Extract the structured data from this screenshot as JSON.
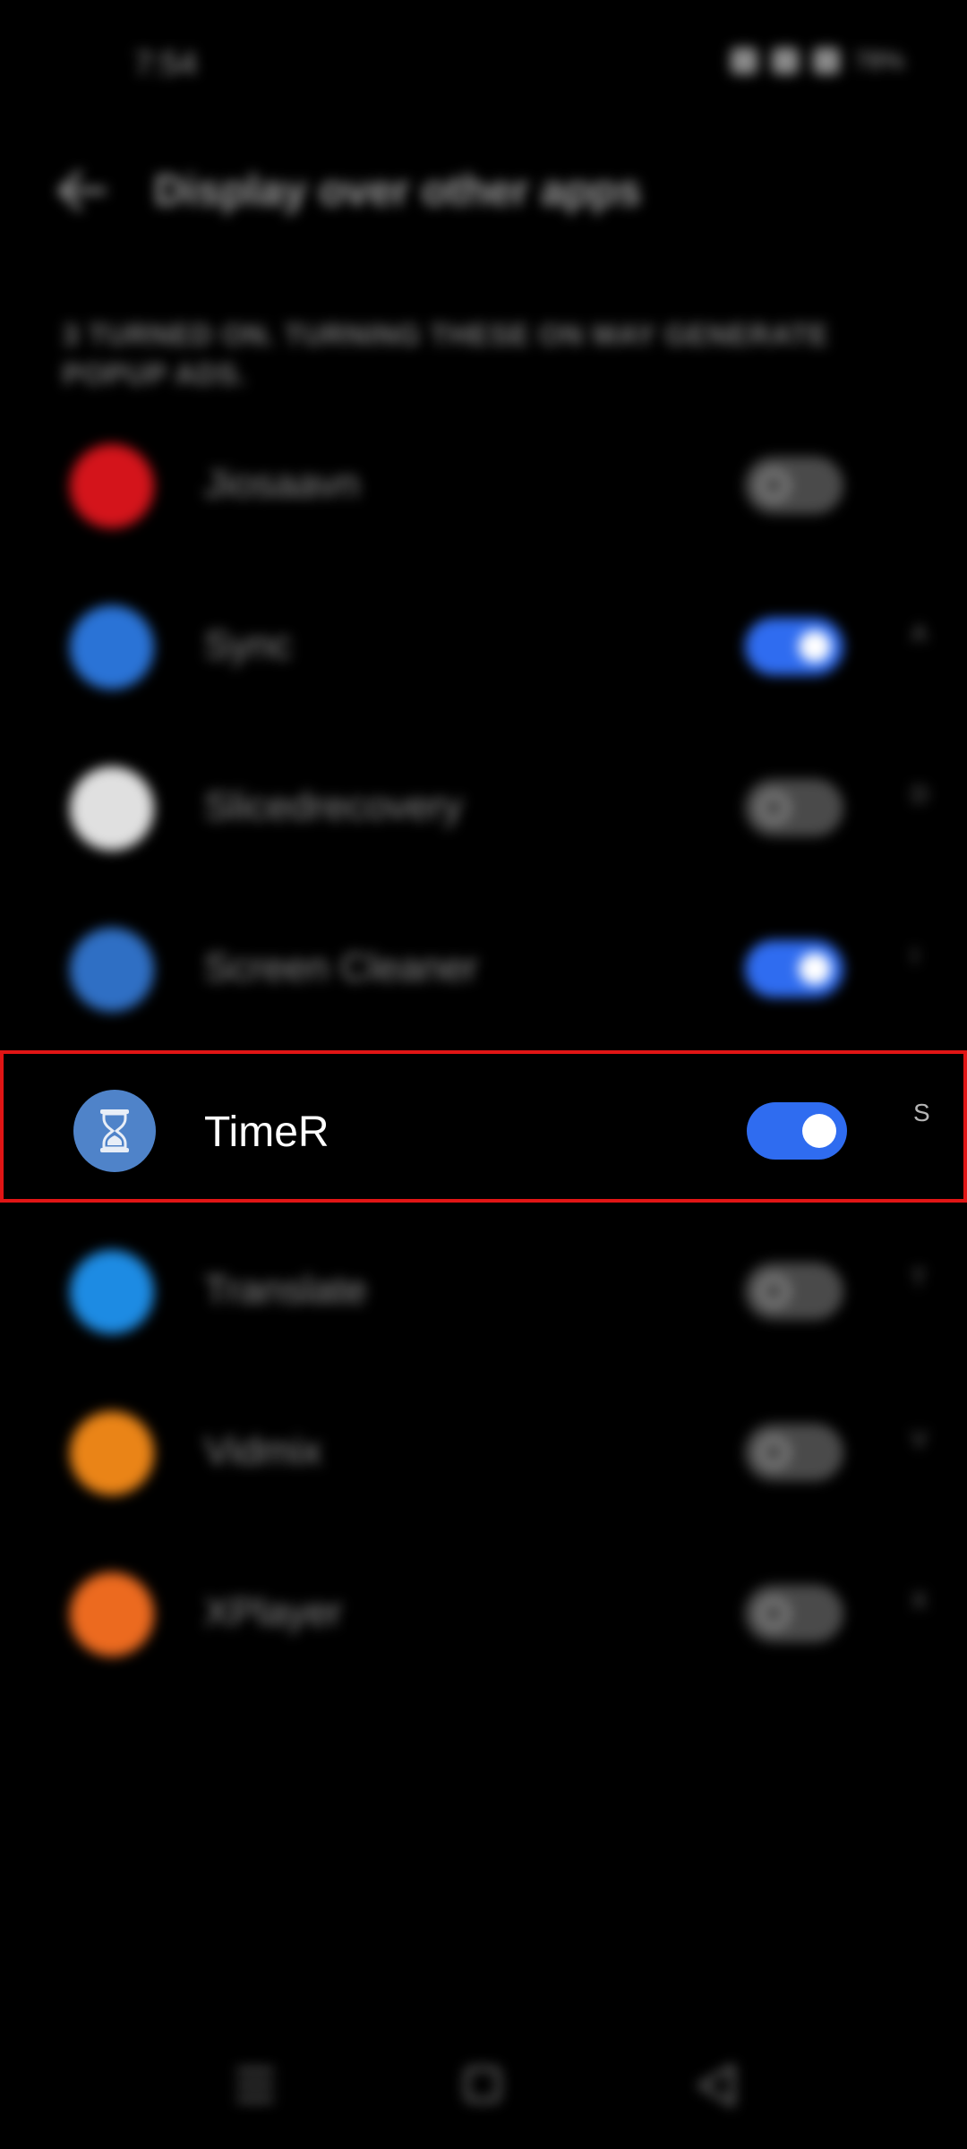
{
  "status_bar": {
    "time": "7:54",
    "battery": "78%"
  },
  "app_bar": {
    "title": "Display over other apps"
  },
  "subtitle": "3 TURNED ON. TURNING THESE ON MAY GENERATE POPUP ADS.",
  "apps": [
    {
      "name": "Jiosaavn",
      "enabled": false,
      "icon_color": "#d4141b",
      "index": ""
    },
    {
      "name": "Sync",
      "enabled": true,
      "icon_color": "#2a73d6",
      "index": "A"
    },
    {
      "name": "Slicedrecovery",
      "enabled": false,
      "icon_color": "#e0e0e0",
      "index": "D"
    },
    {
      "name": "Screen Cleaner",
      "enabled": true,
      "icon_color": "#2f6fc4",
      "index": "I"
    },
    {
      "name": "TimeR",
      "enabled": true,
      "icon_color": "#4f83c9",
      "index": "S",
      "highlighted": true
    },
    {
      "name": "Translate",
      "enabled": false,
      "icon_color": "#1d8be3",
      "index": "T"
    },
    {
      "name": "Vidmix",
      "enabled": false,
      "icon_color": "#ea8417",
      "index": "V"
    },
    {
      "name": "XPlayer",
      "enabled": false,
      "icon_color": "#ec6a1f",
      "index": "X"
    }
  ],
  "colors": {
    "toggle_on": "#2f6cf0",
    "highlight_border": "#e01515",
    "background": "#000000"
  },
  "nav_bar": {
    "icons": [
      "menu-icon",
      "home-icon",
      "back-triangle-icon"
    ]
  }
}
